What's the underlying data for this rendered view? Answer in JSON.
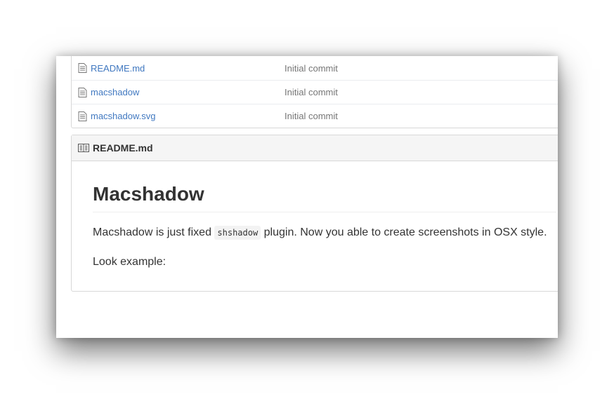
{
  "files": [
    {
      "name": "README.md",
      "message": "Initial commit",
      "icon": "file-text-icon"
    },
    {
      "name": "macshadow",
      "message": "Initial commit",
      "icon": "file-text-icon"
    },
    {
      "name": "macshadow.svg",
      "message": "Initial commit",
      "icon": "file-text-icon"
    }
  ],
  "readme": {
    "header_title": "README.md",
    "header_icon": "book-icon",
    "heading": "Macshadow",
    "para1_before": "Macshadow is just fixed ",
    "para1_code": "shshadow",
    "para1_after": " plugin. Now you able to create screenshots in OSX style.",
    "para2": "Look example:"
  },
  "colors": {
    "link": "#4078c0",
    "muted": "#767676",
    "text": "#333333",
    "header_bg": "#f5f5f5",
    "border": "#d8d8d8"
  }
}
